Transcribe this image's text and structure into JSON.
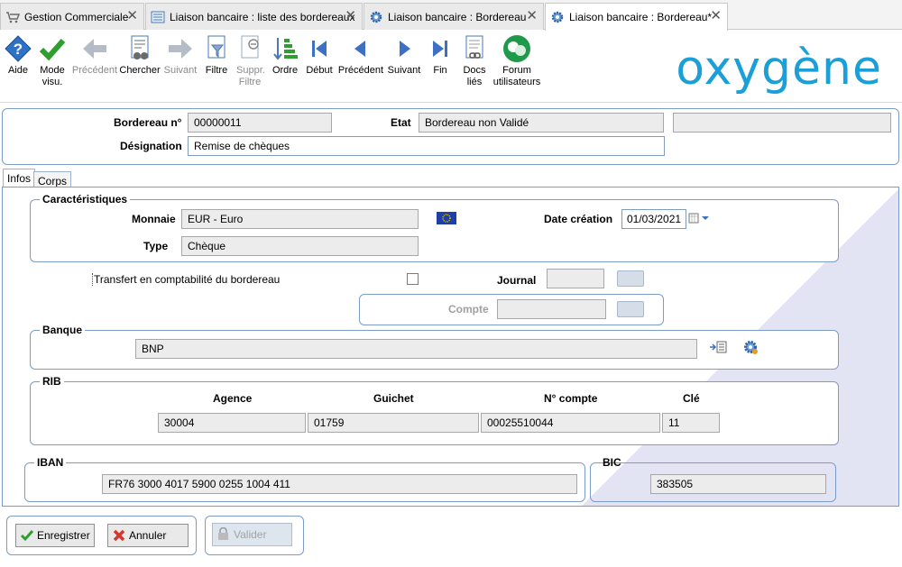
{
  "tabs": [
    {
      "label": "Gestion Commerciale",
      "icon": "cart-icon"
    },
    {
      "label": "Liaison bancaire : liste des bordereaux",
      "icon": "list-icon"
    },
    {
      "label": "Liaison bancaire : Bordereau",
      "icon": "gear-icon"
    },
    {
      "label": "Liaison bancaire : Bordereau*",
      "icon": "gear-icon"
    }
  ],
  "toolbar": {
    "aide": "Aide",
    "mode_visu": "Mode visu.",
    "precedent1": "Précédent",
    "chercher": "Chercher",
    "suivant1": "Suivant",
    "filtre": "Filtre",
    "suppr_filtre": "Suppr. Filtre",
    "ordre": "Ordre",
    "debut": "Début",
    "precedent2": "Précédent",
    "suivant2": "Suivant",
    "fin": "Fin",
    "docs_lies": "Docs liés",
    "forum": "Forum utilisateurs"
  },
  "logo": "oxygène",
  "header": {
    "bordereau_label": "Bordereau n°",
    "bordereau_value": "00000011",
    "etat_label": "Etat",
    "etat_value": "Bordereau non Validé",
    "designation_label": "Désignation",
    "designation_value": "Remise de chèques"
  },
  "subtabs": {
    "infos": "Infos",
    "corps": "Corps"
  },
  "caracteristiques": {
    "title": "Caractéristiques",
    "monnaie_label": "Monnaie",
    "monnaie_value": "EUR - Euro",
    "type_label": "Type",
    "type_value": "Chèque",
    "date_label": "Date création",
    "date_value": "01/03/2021"
  },
  "transfert": {
    "label": "Transfert en comptabilité du bordereau",
    "journal_label": "Journal",
    "compte_label": "Compte"
  },
  "banque": {
    "title": "Banque",
    "value": "BNP"
  },
  "rib": {
    "title": "RIB",
    "agence_label": "Agence",
    "agence_value": "30004",
    "guichet_label": "Guichet",
    "guichet_value": "01759",
    "compte_label": "N° compte",
    "compte_value": "00025510044",
    "cle_label": "Clé",
    "cle_value": "11"
  },
  "iban": {
    "title": "IBAN",
    "value": "FR76  3000  4017  5900  0255  1004  411"
  },
  "bic": {
    "title": "BIC",
    "value": "383505"
  },
  "footer": {
    "enregistrer": "Enregistrer",
    "annuler": "Annuler",
    "valider": "Valider"
  },
  "colors": {
    "accent": "#1a9fd8",
    "border": "#7c9cc8",
    "nav": "#3d6fc2",
    "check": "#2e9e2e"
  }
}
